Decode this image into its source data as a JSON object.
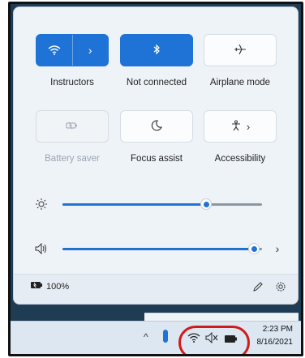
{
  "quick_settings": {
    "tiles_row1": [
      {
        "label": "Instructors",
        "icon": "wifi-icon",
        "state": "on",
        "has_arrow": true
      },
      {
        "label": "Not connected",
        "icon": "bluetooth-icon",
        "state": "on"
      },
      {
        "label": "Airplane mode",
        "icon": "airplane-icon",
        "state": "off"
      }
    ],
    "tiles_row2": [
      {
        "label": "Battery saver",
        "icon": "battery-saver-icon",
        "state": "disabled"
      },
      {
        "label": "Focus assist",
        "icon": "moon-icon",
        "state": "off"
      },
      {
        "label": "Accessibility",
        "icon": "accessibility-icon",
        "state": "off",
        "has_arrow": true
      }
    ],
    "brightness": {
      "icon": "sun-icon",
      "level": 0.72
    },
    "volume": {
      "icon": "speaker-icon",
      "level": 1.0
    },
    "footer": {
      "battery_percent": "100%",
      "battery_icon": "battery-plug-icon",
      "edit_icon": "pencil-icon",
      "settings_icon": "gear-icon"
    }
  },
  "taskbar": {
    "time": "2:23 PM",
    "date": "8/16/2021",
    "tray_icons": [
      "chevron-up-icon",
      "wifi-icon",
      "speaker-muted-icon",
      "battery-plug-icon"
    ]
  },
  "colors": {
    "accent": "#1f73d6",
    "highlight": "#d11b1b"
  }
}
